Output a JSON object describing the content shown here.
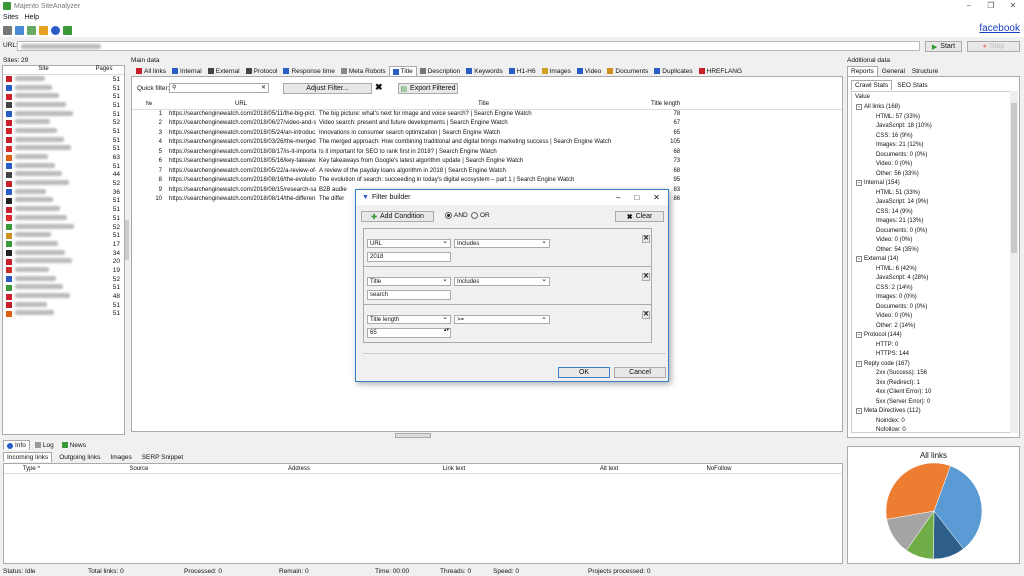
{
  "window": {
    "title": "Majento SiteAnalyzer",
    "link": "facebook"
  },
  "menu": [
    "Sites",
    "Help"
  ],
  "url": {
    "label": "URL:",
    "start": "Start",
    "stop": "Stop"
  },
  "sites": {
    "count_label": "Sites: 29",
    "col_site": "Site",
    "col_pages": "Pages",
    "pages": [
      "51",
      "51",
      "51",
      "51",
      "51",
      "52",
      "51",
      "51",
      "51",
      "63",
      "51",
      "44",
      "52",
      "36",
      "51",
      "51",
      "51",
      "52",
      "51",
      "17",
      "34",
      "20",
      "19",
      "52",
      "51",
      "48",
      "51",
      "51"
    ],
    "icon_colors": [
      "#c8202a",
      "#2a5cc8",
      "#d0202a",
      "#444",
      "#2a5cc8",
      "#c8202a",
      "#d0202a",
      "#c8202a",
      "#d02a2a",
      "#e06010",
      "#2a5cc8",
      "#444",
      "#c8202a",
      "#2a5cc8",
      "#222",
      "#c8202a",
      "#e02a2a",
      "#3a9a3a",
      "#d09020",
      "#3a9a3a",
      "#222",
      "#c8202a",
      "#d02a2a",
      "#2a5cc8",
      "#3a9a3a",
      "#d0202a",
      "#c8202a",
      "#e06010"
    ]
  },
  "main": {
    "label": "Main data",
    "tabs": [
      "All links",
      "Internal",
      "External",
      "Protocol",
      "Response time",
      "Meta Robots",
      "Title",
      "Description",
      "Keywords",
      "H1-H6",
      "Images",
      "Video",
      "Documents",
      "Duplicates",
      "HREFLANG"
    ],
    "quick_filter": "Quick filter:",
    "adjust": "Adjust Filter...",
    "export": "Export Filtered",
    "cols": [
      "№",
      "URL",
      "Title",
      "Title length"
    ],
    "rows": [
      [
        "1",
        "https://searchenginewatch.com/2018/05/11/the-big-pict...",
        "The big picture: what's next for image and voice search? | Search Engine Watch",
        "78"
      ],
      [
        "2",
        "https://searchenginewatch.com/2018/06/27/video-and-s...",
        "Video search: present and future developments | Search Engine Watch",
        "67"
      ],
      [
        "3",
        "https://searchenginewatch.com/2018/05/24/an-introduc...",
        "Innovations in consumer search optimization | Search Engine Watch",
        "65"
      ],
      [
        "4",
        "https://searchenginewatch.com/2018/03/26/the-merged...",
        "The merged approach: How combining traditional and digital brings marketing success | Search Engine Watch",
        "105"
      ],
      [
        "5",
        "https://searchenginewatch.com/2018/08/17/is-it-importa...",
        "Is it important for SEO to rank first in 2018? | Search Engine Watch",
        "68"
      ],
      [
        "6",
        "https://searchenginewatch.com/2018/05/16/key-takeaw...",
        "Key takeaways from Google's latest algorithm update | Search Engine Watch",
        "73"
      ],
      [
        "7",
        "https://searchenginewatch.com/2018/05/22/a-review-of-...",
        "A review of the payday loans algorithm in 2018 | Search Engine Watch",
        "68"
      ],
      [
        "8",
        "https://searchenginewatch.com/2018/08/16/the-evolutio...",
        "The evolution of search: succeeding in today's digital ecosystem – part 1 | Search Engine Watch",
        "95"
      ],
      [
        "9",
        "https://searchenginewatch.com/2018/08/15/research-sa...",
        "B2B audie",
        "83"
      ],
      [
        "10",
        "https://searchenginewatch.com/2018/08/14/the-differen...",
        "The differ",
        "86"
      ]
    ]
  },
  "dialog": {
    "title": "Filter builder",
    "add": "Add Condition",
    "and": "AND",
    "or": "OR",
    "clear": "Clear",
    "ok": "OK",
    "cancel": "Cancel",
    "conds": [
      {
        "field": "URL",
        "op": "Includes",
        "value": "2018"
      },
      {
        "field": "Title",
        "op": "Includes",
        "value": "search"
      },
      {
        "field": "Title length",
        "op": ">=",
        "value": "65"
      }
    ]
  },
  "bottom": {
    "tabs": [
      "Info",
      "Log",
      "News"
    ],
    "subtabs": [
      "Incoming links",
      "Outgoing links",
      "Images",
      "SERP Snippet"
    ],
    "cols": [
      "Type",
      "Source",
      "Address",
      "Link text",
      "Alt text",
      "NoFollow"
    ]
  },
  "additional": {
    "label": "Additional data",
    "tabs": [
      "Reports",
      "General",
      "Structure"
    ],
    "subtabs": [
      "Crawl Stats",
      "SEO Stats"
    ],
    "col": "Value",
    "tree": [
      {
        "t": "All links (168)",
        "l": 0
      },
      {
        "t": "HTML: 57 (33%)",
        "l": 1
      },
      {
        "t": "JavaScript: 18 (10%)",
        "l": 1
      },
      {
        "t": "CSS: 16 (9%)",
        "l": 1
      },
      {
        "t": "Images: 21 (12%)",
        "l": 1
      },
      {
        "t": "Documents: 0 (0%)",
        "l": 1
      },
      {
        "t": "Video: 0 (0%)",
        "l": 1
      },
      {
        "t": "Other: 56 (33%)",
        "l": 1
      },
      {
        "t": "Internal (154)",
        "l": 0
      },
      {
        "t": "HTML: 51 (33%)",
        "l": 1
      },
      {
        "t": "JavaScript: 14 (9%)",
        "l": 1
      },
      {
        "t": "CSS: 14 (9%)",
        "l": 1
      },
      {
        "t": "Images: 21 (13%)",
        "l": 1
      },
      {
        "t": "Documents: 0 (0%)",
        "l": 1
      },
      {
        "t": "Video: 0 (0%)",
        "l": 1
      },
      {
        "t": "Other: 54 (35%)",
        "l": 1
      },
      {
        "t": "External (14)",
        "l": 0
      },
      {
        "t": "HTML: 6 (42%)",
        "l": 1
      },
      {
        "t": "JavaScript: 4 (28%)",
        "l": 1
      },
      {
        "t": "CSS: 2 (14%)",
        "l": 1
      },
      {
        "t": "Images: 0 (0%)",
        "l": 1
      },
      {
        "t": "Documents: 0 (0%)",
        "l": 1
      },
      {
        "t": "Video: 0 (0%)",
        "l": 1
      },
      {
        "t": "Other: 2 (14%)",
        "l": 1
      },
      {
        "t": "Protocol (144)",
        "l": 0
      },
      {
        "t": "HTTP: 0",
        "l": 1
      },
      {
        "t": "HTTPS: 144",
        "l": 1
      },
      {
        "t": "Reply code (167)",
        "l": 0
      },
      {
        "t": "2xx (Success): 156",
        "l": 1
      },
      {
        "t": "3xx (Redirect): 1",
        "l": 1
      },
      {
        "t": "4xx (Client Error): 10",
        "l": 1
      },
      {
        "t": "5xx (Server Error): 0",
        "l": 1
      },
      {
        "t": "Meta Directives (112)",
        "l": 0
      },
      {
        "t": "Noindex: 0",
        "l": 1
      },
      {
        "t": "Nofollow: 0",
        "l": 1
      }
    ]
  },
  "chart_data": {
    "type": "pie",
    "title": "All links",
    "categories": [
      "HTML",
      "JavaScript",
      "CSS",
      "Images",
      "Documents",
      "Video",
      "Other"
    ],
    "values": [
      57,
      18,
      16,
      21,
      0,
      0,
      56
    ],
    "colors": [
      "#5b9bd5",
      "#2e5f8a",
      "#70ad47",
      "#a5a5a5",
      "#ffc000",
      "#4472c4",
      "#ed7d31"
    ]
  },
  "status": {
    "status": "Status: Idle",
    "total": "Total links: 0",
    "processed": "Processed: 0",
    "remain": "Remain: 0",
    "time": "Time: 00:00",
    "threads": "Threads: 0",
    "speed": "Speed: 0",
    "projects": "Projects processed: 0"
  }
}
